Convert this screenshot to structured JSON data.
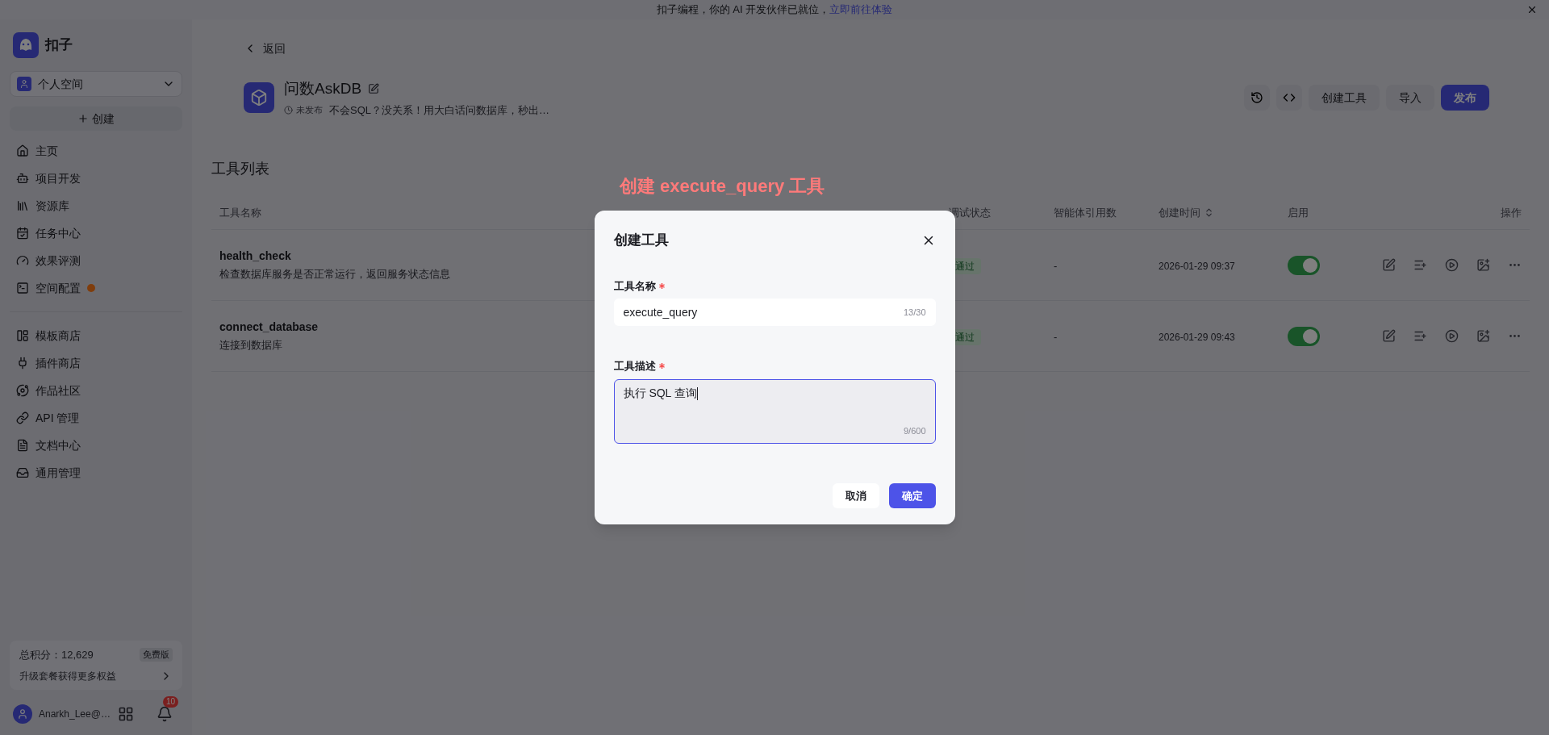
{
  "banner": {
    "text": "扣子编程，你的 AI 开发伙伴已就位，",
    "link": "立即前往体验"
  },
  "sidebar": {
    "brand": "扣子",
    "workspace": "个人空间",
    "create_button": "创建",
    "nav_groups": [
      [
        {
          "label": "主页",
          "dot": false
        },
        {
          "label": "项目开发",
          "dot": false
        },
        {
          "label": "资源库",
          "dot": false
        },
        {
          "label": "任务中心",
          "dot": false
        },
        {
          "label": "效果评测",
          "dot": false
        },
        {
          "label": "空间配置",
          "dot": true
        }
      ],
      [
        {
          "label": "模板商店",
          "dot": false
        },
        {
          "label": "插件商店",
          "dot": false
        },
        {
          "label": "作品社区",
          "dot": false
        },
        {
          "label": "API 管理",
          "dot": false
        },
        {
          "label": "文档中心",
          "dot": false
        },
        {
          "label": "通用管理",
          "dot": false
        }
      ]
    ],
    "points": {
      "label": "总积分：12,629",
      "plan": "免费版",
      "upgrade": "升级套餐获得更多权益"
    },
    "user": {
      "name": "Anarkh_Lee@…",
      "notifications": "10"
    }
  },
  "header": {
    "back": "返回",
    "app_name": "问数AskDB",
    "status": "未发布",
    "description": "不会SQL？没关系！用大白话问数据库，秒出…",
    "buttons": [
      "创建工具",
      "导入"
    ],
    "publish": "发布"
  },
  "section_title": "工具列表",
  "table": {
    "columns": [
      "工具名称",
      "调试状态",
      "智能体引用数",
      "创建时间",
      "启用",
      "操作"
    ],
    "rows": [
      {
        "name": "health_check",
        "description": "检查数据库服务是否正常运行，返回服务状态信息",
        "debug_status": "通过",
        "agent_refs": "-",
        "created": "2026-01-29 09:37",
        "enabled": true
      },
      {
        "name": "connect_database",
        "description": "连接到数据库",
        "debug_status": "通过",
        "agent_refs": "-",
        "created": "2026-01-29 09:43",
        "enabled": true
      }
    ]
  },
  "annotation": "创建 execute_query 工具",
  "dialog": {
    "title": "创建工具",
    "fields": [
      {
        "kind": "input",
        "label": "工具名称",
        "required": true,
        "value": "execute_query",
        "count": "13/30",
        "focused": false
      },
      {
        "kind": "textarea",
        "label": "工具描述",
        "required": true,
        "value": "执行 SQL 查询",
        "count": "9/600",
        "focused": true
      }
    ],
    "cancel": "取消",
    "confirm": "确定"
  }
}
